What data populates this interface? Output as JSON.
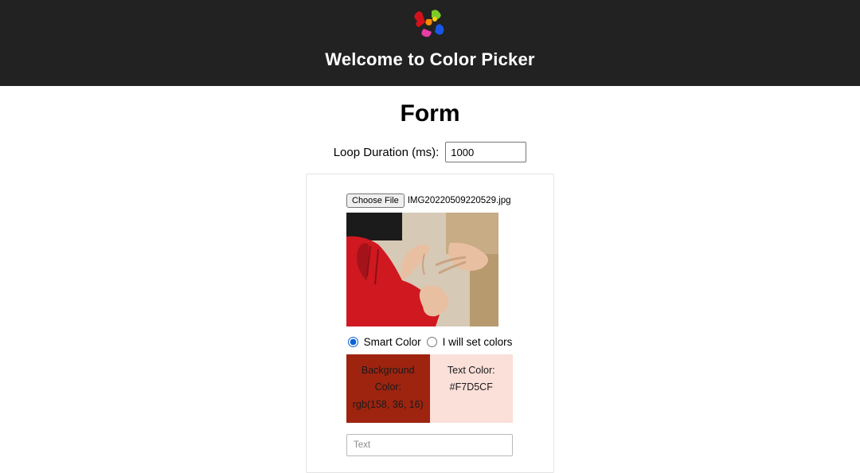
{
  "header": {
    "welcome": "Welcome to Color Picker"
  },
  "page": {
    "title": "Form"
  },
  "form": {
    "loop_label": "Loop Duration (ms):",
    "loop_value": "1000",
    "choose_file_label": "Choose File",
    "selected_file_name": "IMG20220509220529.jpg",
    "radio_smart_label": "Smart Color",
    "radio_manual_label": "I will set colors",
    "radio_selected": "smart",
    "bg_swatch_title": "Background Color:",
    "bg_swatch_value": "rgb(158, 36, 16)",
    "text_swatch_title": "Text Color:",
    "text_swatch_value": "#F7D5CF",
    "text_placeholder": "Text"
  }
}
